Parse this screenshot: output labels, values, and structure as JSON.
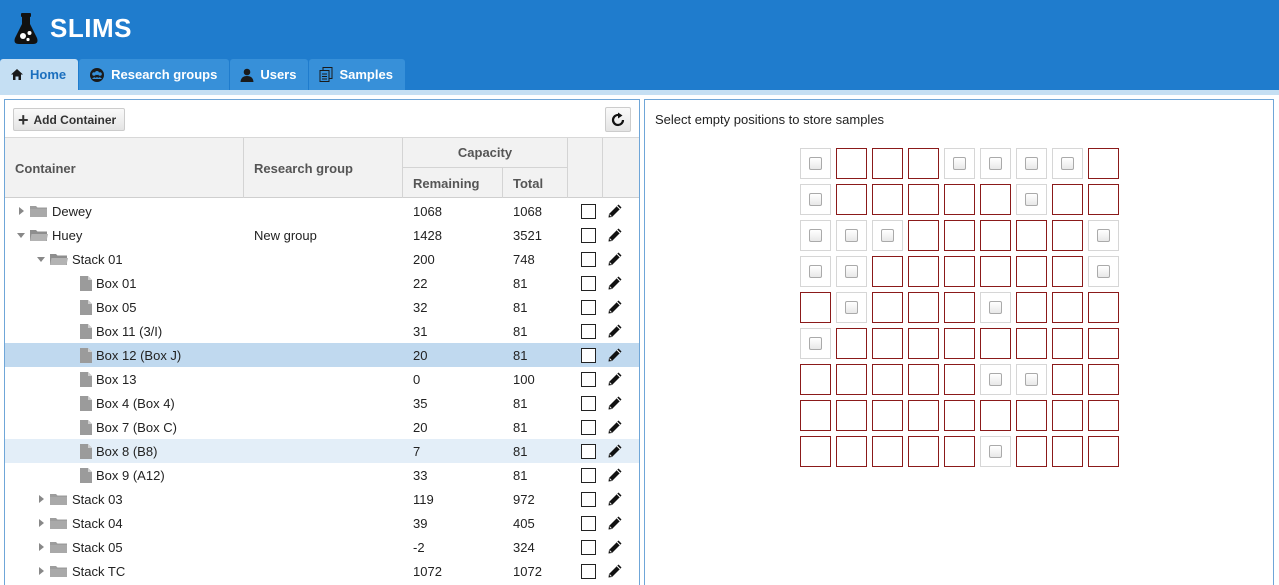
{
  "app": {
    "title": "SLIMS"
  },
  "tabs": [
    {
      "label": "Home",
      "icon": "home-icon",
      "active": true
    },
    {
      "label": "Research groups",
      "icon": "group-icon",
      "active": false
    },
    {
      "label": "Users",
      "icon": "user-icon",
      "active": false
    },
    {
      "label": "Samples",
      "icon": "samples-icon",
      "active": false
    }
  ],
  "toolbar": {
    "add_label": "Add Container"
  },
  "table": {
    "headers": {
      "container": "Container",
      "group": "Research group",
      "capacity": "Capacity",
      "remaining": "Remaining",
      "total": "Total"
    },
    "rows": [
      {
        "name": "Dewey",
        "group": "",
        "remaining": "1068",
        "total": "1068",
        "level": 0,
        "type": "folder",
        "expand": "collapsed",
        "state": ""
      },
      {
        "name": "Huey",
        "group": "New group",
        "remaining": "1428",
        "total": "3521",
        "level": 0,
        "type": "folder-open",
        "expand": "expanded",
        "state": ""
      },
      {
        "name": "Stack 01",
        "group": "",
        "remaining": "200",
        "total": "748",
        "level": 1,
        "type": "folder-open",
        "expand": "expanded",
        "state": ""
      },
      {
        "name": "Box 01",
        "group": "",
        "remaining": "22",
        "total": "81",
        "level": 2,
        "type": "file",
        "expand": "none",
        "state": ""
      },
      {
        "name": "Box 05",
        "group": "",
        "remaining": "32",
        "total": "81",
        "level": 2,
        "type": "file",
        "expand": "none",
        "state": ""
      },
      {
        "name": "Box 11 (3/I)",
        "group": "",
        "remaining": "31",
        "total": "81",
        "level": 2,
        "type": "file",
        "expand": "none",
        "state": ""
      },
      {
        "name": "Box 12 (Box J)",
        "group": "",
        "remaining": "20",
        "total": "81",
        "level": 2,
        "type": "file",
        "expand": "none",
        "state": "selected"
      },
      {
        "name": "Box 13",
        "group": "",
        "remaining": "0",
        "total": "100",
        "level": 2,
        "type": "file",
        "expand": "none",
        "state": ""
      },
      {
        "name": "Box 4 (Box 4)",
        "group": "",
        "remaining": "35",
        "total": "81",
        "level": 2,
        "type": "file",
        "expand": "none",
        "state": ""
      },
      {
        "name": "Box 7 (Box C)",
        "group": "",
        "remaining": "20",
        "total": "81",
        "level": 2,
        "type": "file",
        "expand": "none",
        "state": ""
      },
      {
        "name": "Box 8 (B8)",
        "group": "",
        "remaining": "7",
        "total": "81",
        "level": 2,
        "type": "file",
        "expand": "none",
        "state": "hover"
      },
      {
        "name": "Box 9 (A12)",
        "group": "",
        "remaining": "33",
        "total": "81",
        "level": 2,
        "type": "file",
        "expand": "none",
        "state": ""
      },
      {
        "name": "Stack 03",
        "group": "",
        "remaining": "119",
        "total": "972",
        "level": 1,
        "type": "folder",
        "expand": "collapsed",
        "state": ""
      },
      {
        "name": "Stack 04",
        "group": "",
        "remaining": "39",
        "total": "405",
        "level": 1,
        "type": "folder",
        "expand": "collapsed",
        "state": ""
      },
      {
        "name": "Stack 05",
        "group": "",
        "remaining": "-2",
        "total": "324",
        "level": 1,
        "type": "folder",
        "expand": "collapsed",
        "state": ""
      },
      {
        "name": "Stack TC",
        "group": "",
        "remaining": "1072",
        "total": "1072",
        "level": 1,
        "type": "folder",
        "expand": "collapsed",
        "state": ""
      }
    ]
  },
  "positions": {
    "prompt": "Select empty positions to store samples",
    "grid": [
      "EFFFEEEEF",
      "EFFFFFEFF",
      "EEEFFFFFE",
      "EEFFFFFFE",
      "FEFFFEFFF",
      "EFFFFFFFF",
      "FFFFFEEFF",
      "FFFFFFFFF",
      "FFFFFEFFF"
    ]
  },
  "colors": {
    "header": "#1f7ccd",
    "tab": "#3790d9",
    "tab_active_bg": "#c5dff3",
    "occupied_border": "#8b1a1a",
    "selected_row": "#c0d9ef"
  }
}
